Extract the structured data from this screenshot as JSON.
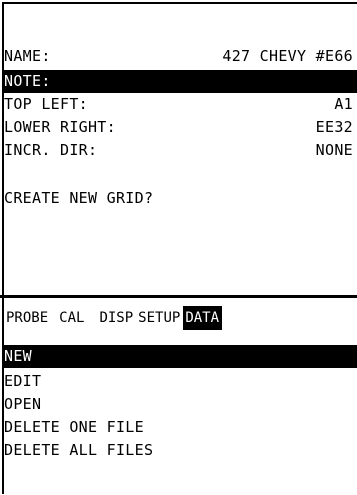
{
  "form": {
    "name_label": "NAME:",
    "name_value": "427 CHEVY #E66",
    "note_label": "NOTE:",
    "top_left_label": "TOP LEFT:",
    "top_left_value": "A1",
    "lower_right_label": "LOWER RIGHT:",
    "lower_right_value": "EE32",
    "incr_dir_label": "INCR. DIR:",
    "incr_dir_value": "NONE",
    "prompt": "CREATE NEW GRID?"
  },
  "menubar": {
    "tabs": [
      "PROBE",
      "CAL",
      "DISP",
      "SETUP",
      "DATA"
    ],
    "active": "DATA"
  },
  "menu": {
    "items": [
      "NEW",
      "EDIT",
      "OPEN",
      "DELETE ONE FILE",
      "DELETE ALL FILES"
    ],
    "selected": "NEW"
  }
}
